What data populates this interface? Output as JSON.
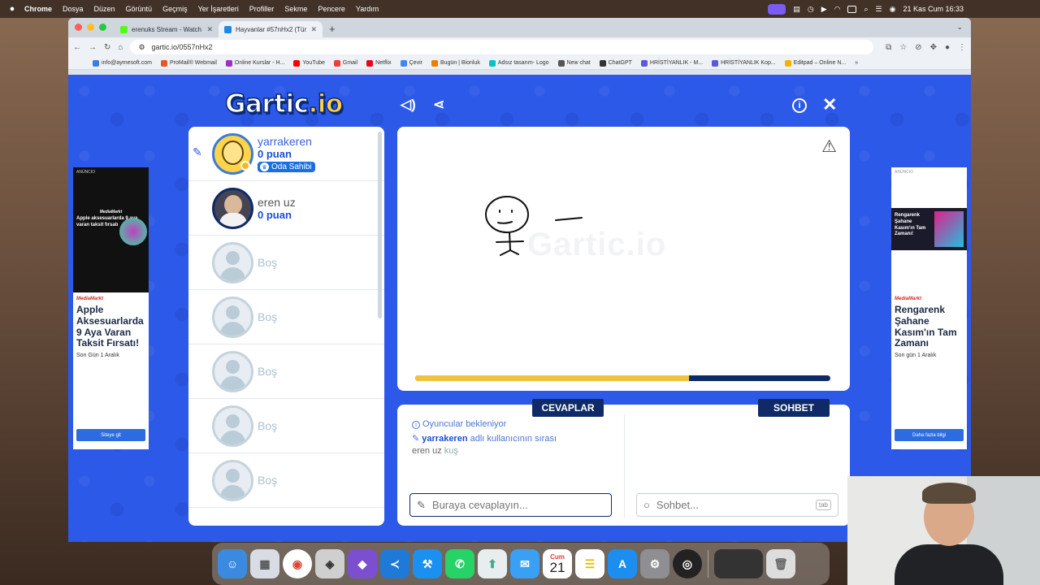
{
  "menubar": {
    "items": [
      "Chrome",
      "Dosya",
      "Düzen",
      "Görüntü",
      "Geçmiş",
      "Yer İşaretleri",
      "Profiller",
      "Sekme",
      "Pencere",
      "Yardım"
    ],
    "clock": "21 Kas Cum  16:33"
  },
  "tabs": [
    {
      "title": "erenuks Stream - Watch Live",
      "color": "#53fc18"
    },
    {
      "title": "Hayvanlar #57nHx2 (Türkçe)",
      "color": "#1e88e5"
    }
  ],
  "address": {
    "url": "gartic.io/0557nHx2"
  },
  "bookmarks": [
    "info@aymesoft.com",
    "ProMail® Webmail",
    "Online Kurslar - H...",
    "YouTube",
    "Gmail",
    "Netflix",
    "Çevir",
    "Bugün | Bionluk",
    "Adsız tasarım- Logo",
    "New chat",
    "ChatGPT",
    "HRİSTİYANLIK - M...",
    "HRİSTİYANLIK Kop...",
    "Editpad – Online N..."
  ],
  "game": {
    "logo_main": "Gartic",
    "logo_io": ".io",
    "watermark": "Gartic.io",
    "timer_fraction": 0.66,
    "players": [
      {
        "name": "yarrakeren",
        "points": "0 puan",
        "badge": "Oda Sahibi",
        "role": "drawer"
      },
      {
        "name": "eren uz",
        "points": "0 puan"
      }
    ],
    "empty_label": "Boş",
    "empty_slots": 5,
    "answers_tab": "CEVAPLAR",
    "chat_tab": "SOHBET",
    "log_waiting": "Oyuncular bekleniyor",
    "log_turn_user": "yarrakeren",
    "log_turn_text": " adlı kullanıcının sırası",
    "log_guess_user": "eren uz",
    "log_guess_word": "kuş",
    "answer_placeholder": "Buraya cevaplayın...",
    "chat_placeholder": "Sohbet...",
    "tab_key": "tab"
  },
  "ads": {
    "left": {
      "label": "ANÚNCIO",
      "brand": "MediaMarkt",
      "promo": "Apple aksesuarlarda 9 aya varan taksit fırsatı",
      "headline": "Apple Aksesuarlarda 9 Aya Varan Taksit Fırsatı!",
      "sub": "Son Gün 1 Aralık",
      "button": "Siteye git"
    },
    "right": {
      "label": "ANÚNCIO",
      "brand": "MediaMarkt",
      "promo": "Rengarenk Şahane Kasım'ın Tam Zamanı!",
      "headline": "Rengarenk Şahane Kasım'ın Tam Zamanı",
      "sub": "Son gün 1 Aralık",
      "button": "Daha fazla bilgi"
    }
  },
  "dock": {
    "calendar_month": "Cum",
    "calendar_day": "21"
  }
}
